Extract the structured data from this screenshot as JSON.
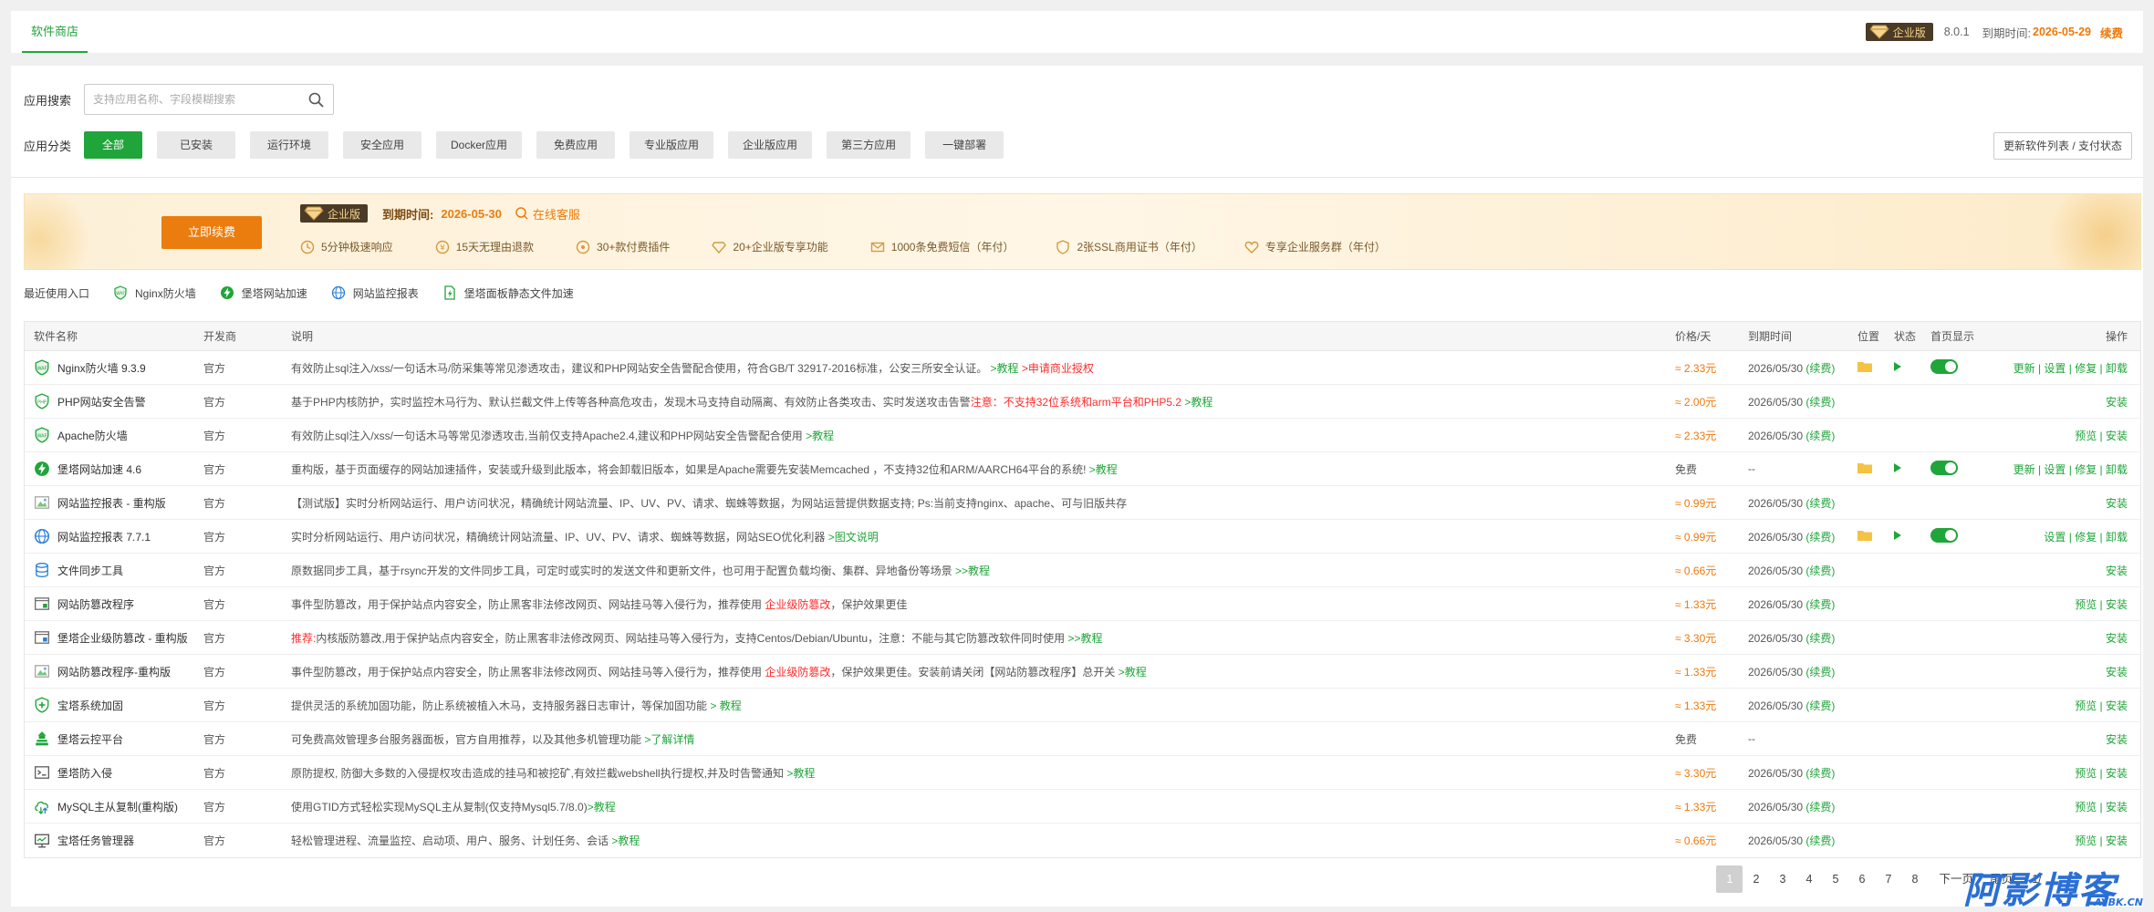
{
  "topbar": {
    "tab": "软件商店",
    "edition_badge": "企业版",
    "version": "8.0.1",
    "expire_label": "到期时间:",
    "expire_date": "2026-05-29",
    "renew": "续费"
  },
  "search": {
    "label": "应用搜索",
    "placeholder": "支持应用名称、字段模糊搜索"
  },
  "categories": {
    "label": "应用分类",
    "items": [
      "全部",
      "已安装",
      "运行环境",
      "安全应用",
      "Docker应用",
      "免费应用",
      "专业版应用",
      "企业版应用",
      "第三方应用",
      "一键部署"
    ],
    "active": "全部",
    "refresh_button": "更新软件列表 / 支付状态"
  },
  "promo": {
    "renew_button": "立即续费",
    "badge": "企业版",
    "expire_label": "到期时间:",
    "expire_date": "2026-05-30",
    "online_service": "在线客服",
    "features": [
      "5分钟极速响应",
      "15天无理由退款",
      "30+款付费插件",
      "20+企业版专享功能",
      "1000条免费短信（年付）",
      "2张SSL商用证书（年付）",
      "专享企业服务群（年付）"
    ]
  },
  "recent": {
    "label": "最近使用入口",
    "items": [
      "Nginx防火墙",
      "堡塔网站加速",
      "网站监控报表",
      "堡塔面板静态文件加速"
    ]
  },
  "table": {
    "headers": {
      "name": "软件名称",
      "dev": "开发商",
      "desc": "说明",
      "price": "价格/天",
      "expire": "到期时间",
      "pos": "位置",
      "state": "状态",
      "home": "首页显示",
      "op": "操作"
    },
    "rows": [
      {
        "name": "Nginx防火墙 9.3.9",
        "dev": "官方",
        "desc": "有效防止sql注入/xss/一句话木马/防采集等常见渗透攻击，建议和PHP网站安全告警配合使用，符合GB/T 32917-2016标准，公安三所安全认证。",
        "desc_link": ">教程",
        "desc_red": ">申请商业授权",
        "price": "≈ 2.33元",
        "expire": "2026/05/30",
        "renew": "(续费)",
        "op": "更新 | 设置 | 修复 | 卸载"
      },
      {
        "name": "PHP网站安全告警",
        "dev": "官方",
        "desc": "基于PHP内核防护，实时监控木马行为、默认拦截文件上传等各种高危攻击，发现木马支持自动隔离、有效防止各类攻击、实时发送攻击告警",
        "desc_red": "注意：不支持32位系统和arm平台和PHP5.2",
        "desc_link": ">教程",
        "price": "≈ 2.00元",
        "expire": "2026/05/30",
        "renew": "(续费)",
        "op": "安装"
      },
      {
        "name": "Apache防火墙",
        "dev": "官方",
        "desc": "有效防止sql注入/xss/一句话木马等常见渗透攻击,当前仅支持Apache2.4,建议和PHP网站安全告警配合使用",
        "desc_link": ">教程",
        "price": "≈ 2.33元",
        "expire": "2026/05/30",
        "renew": "(续费)",
        "op": "预览 | 安装"
      },
      {
        "name": "堡塔网站加速 4.6",
        "dev": "官方",
        "desc": "重构版，基于页面缓存的网站加速插件，安装或升级到此版本，将会卸载旧版本，如果是Apache需要先安装Memcached ，不支持32位和ARM/AARCH64平台的系统!",
        "desc_link": ">教程",
        "price": "免费",
        "expire": "--",
        "renew": "",
        "op": "更新 | 设置 | 修复 | 卸载"
      },
      {
        "name": "网站监控报表 - 重构版",
        "dev": "官方",
        "desc": "【测试版】实时分析网站运行、用户访问状况，精确统计网站流量、IP、UV、PV、请求、蜘蛛等数据，为网站运营提供数据支持; Ps:当前支持nginx、apache、可与旧版共存",
        "price": "≈ 0.99元",
        "expire": "2026/05/30",
        "renew": "(续费)",
        "op": "安装"
      },
      {
        "name": "网站监控报表 7.7.1",
        "dev": "官方",
        "desc": "实时分析网站运行、用户访问状况，精确统计网站流量、IP、UV、PV、请求、蜘蛛等数据，网站SEO优化利器",
        "desc_link": ">图文说明",
        "price": "≈ 0.99元",
        "expire": "2026/05/30",
        "renew": "(续费)",
        "op": "设置 | 修复 | 卸载"
      },
      {
        "name": "文件同步工具",
        "dev": "官方",
        "desc": "原数据同步工具，基于rsync开发的文件同步工具，可定时或实时的发送文件和更新文件，也可用于配置负载均衡、集群、异地备份等场景",
        "desc_link": ">>教程",
        "price": "≈ 0.66元",
        "expire": "2026/05/30",
        "renew": "(续费)",
        "op": "安装"
      },
      {
        "name": "网站防篡改程序",
        "dev": "官方",
        "desc": "事件型防篡改，用于保护站点内容安全，防止黑客非法修改网页、网站挂马等入侵行为，推荐使用",
        "desc_red": "企业级防篡改",
        "desc_tail": "，保护效果更佳",
        "price": "≈ 1.33元",
        "expire": "2026/05/30",
        "renew": "(续费)",
        "op": "预览 | 安装"
      },
      {
        "name": "堡塔企业级防篡改 - 重构版",
        "dev": "官方",
        "desc_prefix_red": "推荐:",
        "desc": "内核版防篡改,用于保护站点内容安全，防止黑客非法修改网页、网站挂马等入侵行为，支持Centos/Debian/Ubuntu，注意：不能与其它防篡改软件同时使用",
        "desc_link": ">>教程",
        "price": "≈ 3.30元",
        "expire": "2026/05/30",
        "renew": "(续费)",
        "op": "安装"
      },
      {
        "name": "网站防篡改程序-重构版",
        "dev": "官方",
        "desc": "事件型防篡改，用于保护站点内容安全，防止黑客非法修改网页、网站挂马等入侵行为，推荐使用",
        "desc_red": "企业级防篡改",
        "desc_tail": "，保护效果更佳。安装前请关闭【网站防篡改程序】总开关",
        "desc_link": ">教程",
        "price": "≈ 1.33元",
        "expire": "2026/05/30",
        "renew": "(续费)",
        "op": "安装"
      },
      {
        "name": "宝塔系统加固",
        "dev": "官方",
        "desc": "提供灵活的系统加固功能，防止系统被植入木马，支持服务器日志审计，等保加固功能",
        "desc_link": "> 教程",
        "price": "≈ 1.33元",
        "expire": "2026/05/30",
        "renew": "(续费)",
        "op": "预览 | 安装"
      },
      {
        "name": "堡塔云控平台",
        "dev": "官方",
        "desc": "可免费高效管理多台服务器面板，官方自用推荐，以及其他多机管理功能",
        "desc_link": ">了解详情",
        "price": "免费",
        "expire": "--",
        "renew": "",
        "op": "安装"
      },
      {
        "name": "堡塔防入侵",
        "dev": "官方",
        "desc": "原防提权, 防御大多数的入侵提权攻击造成的挂马和被挖矿,有效拦截webshell执行提权,并及时告警通知",
        "desc_link": ">教程",
        "price": "≈ 3.30元",
        "expire": "2026/05/30",
        "renew": "(续费)",
        "op": "预览 | 安装"
      },
      {
        "name": "MySQL主从复制(重构版)",
        "dev": "官方",
        "desc": "使用GTID方式轻松实现MySQL主从复制(仅支持Mysql5.7/8.0)",
        "desc_link": ">教程",
        "price": "≈ 1.33元",
        "expire": "2026/05/30",
        "renew": "(续费)",
        "op": "预览 | 安装"
      },
      {
        "name": "宝塔任务管理器",
        "dev": "官方",
        "desc": "轻松管理进程、流量监控、启动项、用户、服务、计划任务、会话",
        "desc_link": ">教程",
        "price": "≈ 0.66元",
        "expire": "2026/05/30",
        "renew": "(续费)",
        "op": "预览 | 安装"
      }
    ]
  },
  "pagination": {
    "pages": [
      "1",
      "2",
      "3",
      "4",
      "5",
      "6",
      "7",
      "8"
    ],
    "active": "1",
    "next": "下一页",
    "last": "尾页",
    "info": "1/"
  },
  "watermark": {
    "text": "阿影博客",
    "sub": "AYBK.CN"
  },
  "colors": {
    "accent": "#20a53a",
    "price": "#f07807",
    "warning": "#ff2b2b",
    "renew_button": "#ea7d0e"
  }
}
